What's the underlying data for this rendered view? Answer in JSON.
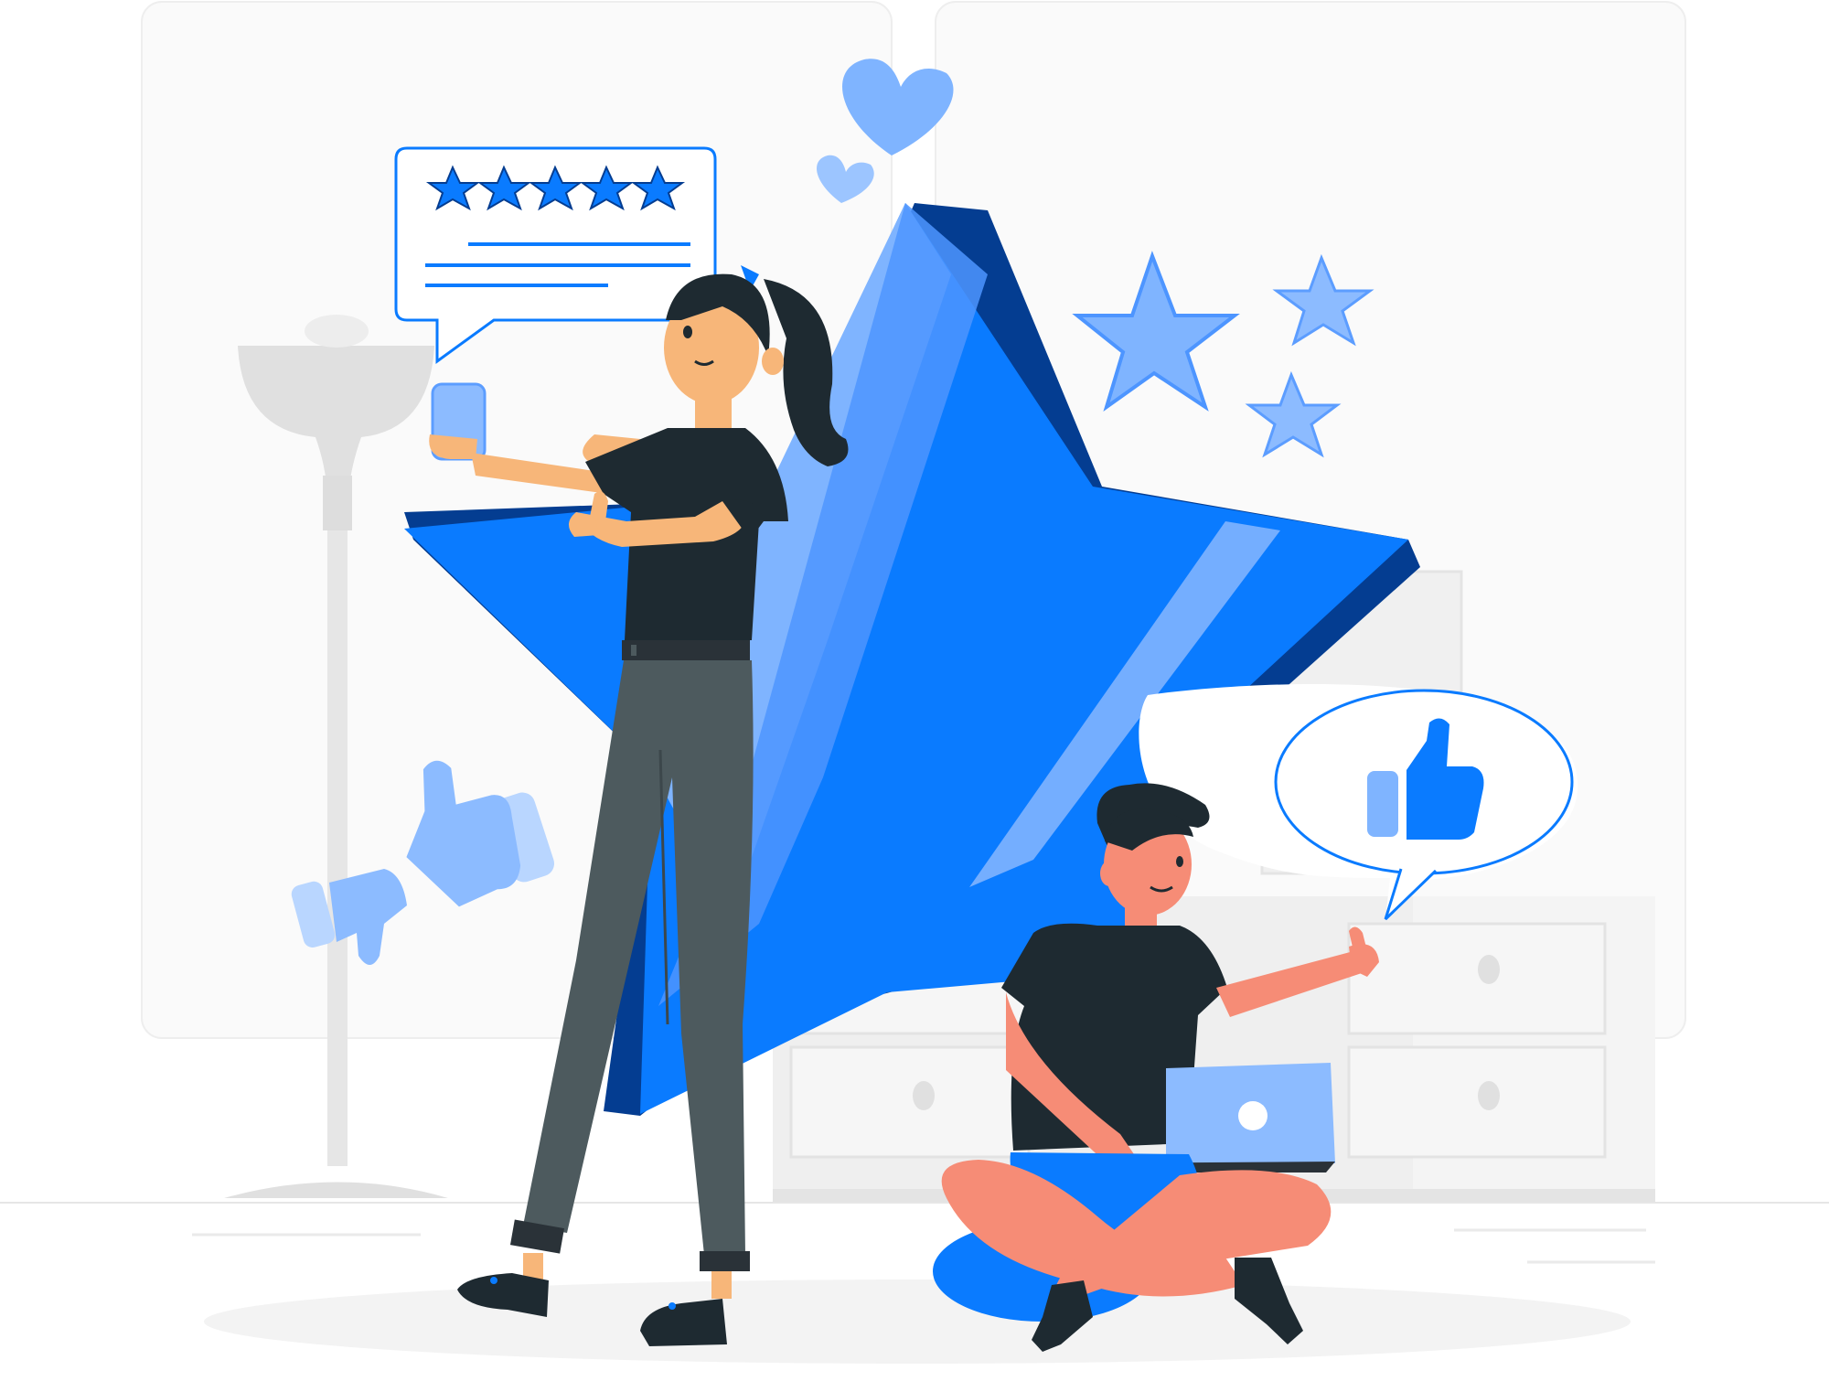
{
  "scene": {
    "subject": "review-rating-illustration",
    "rating_stars": 5,
    "rating_max": 5
  },
  "colors": {
    "primary": "#0A7BFF",
    "primary_dark": "#043D91",
    "primary_light": "#7FB4FF",
    "primary_pale": "#B9D6FF",
    "skin_light": "#F7B679",
    "skin_coral": "#F68C76",
    "hair_dark": "#1E2A31",
    "shirt_dark": "#1E2A31",
    "pants_gray": "#4D5A5E",
    "furniture_gray": "#EBEBEB",
    "floor_shadow": "#F5F5F5",
    "background_panel": "#FAFAFA"
  },
  "icons": [
    "big-star-icon",
    "heart-icon",
    "speech-bubble-icon",
    "thumbs-up-icon",
    "thumbs-down-icon",
    "smartphone-icon",
    "laptop-icon",
    "lamp-icon",
    "dresser-icon"
  ]
}
